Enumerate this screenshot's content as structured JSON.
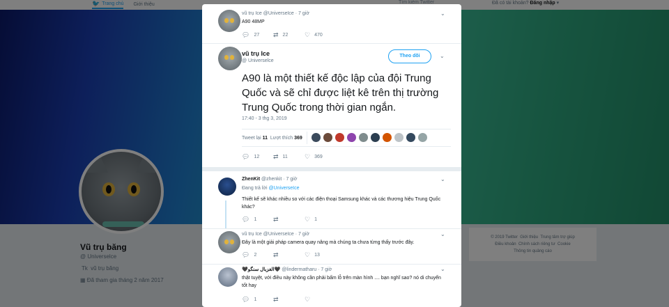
{
  "topbar": {
    "home": "Trang chủ",
    "about": "Giới thiệu",
    "search_placeholder": "Tìm kiếm Twitter",
    "have_account": "Đã có tài khoản?",
    "login": "Đăng nhập"
  },
  "profile": {
    "name": "Vũ trụ băng",
    "handle": "@ Universelce",
    "follows_badge": "Tk",
    "follows_name": "vũ trụ băng",
    "joined": "Đã tham gia tháng 2 năm 2017"
  },
  "footer": {
    "links": [
      "© 2019 Twitter",
      "Giới thiệu",
      "Trung tâm trợ giúp",
      "Điều khoản",
      "Chính sách riêng tư",
      "Cookie",
      "Thông tin quảng cáo"
    ]
  },
  "tweets": {
    "prev": {
      "author": "vũ trụ Ice",
      "handle": "@UniverseIce",
      "time": "· 7 giờ",
      "text": "A90 48MP",
      "replies": "27",
      "retweets": "22",
      "likes": "470"
    },
    "main": {
      "author": "vũ trụ Ice",
      "handle": "@ Universelce",
      "follow": "Theo dõi",
      "text": "A90 là một thiết kế độc lập của đội Trung Quốc và sẽ chỉ được liệt kê trên thị trường Trung Quốc trong thời gian ngắn.",
      "timestamp": "17:40 - 3 thg 3, 2019",
      "retweet_label": "Tweet lại",
      "retweet_count": "11",
      "like_label": "Lượt thích",
      "like_count": "369",
      "likers": [
        "#3b4a5c",
        "#6b4a3a",
        "#c0392b",
        "#8e44ad",
        "#7f8c8d",
        "#2c3e50",
        "#d35400",
        "#bdc3c7",
        "#34495e",
        "#95a5a6"
      ],
      "replies": "12",
      "retweets": "11",
      "likes": "369"
    },
    "reply1": {
      "author": "ZhenKit",
      "handle": "@zhenkit",
      "time": "· 7 giờ",
      "replying": "Đang trả lời",
      "replying_to": "@UniverseIce",
      "text": "Thiết kế sẽ khác nhiều so với các điện thoại Samsung khác và các thương hiệu Trung Quốc khác?",
      "replies": "1",
      "retweets": "",
      "likes": "1"
    },
    "reply2": {
      "author": "vũ trụ Ice",
      "handle": "@UniverseIce",
      "time": "· 7 giờ",
      "text": "Đây là một giải pháp camera quay nâng mà chúng ta chưa từng thấy trước đây.",
      "replies": "2",
      "retweets": "",
      "likes": "13"
    },
    "reply3": {
      "author": "🖤الغزبال سنگو🖤",
      "handle": "@lindermatharu",
      "time": "· 7 giờ",
      "text": "thật tuyệt, với điều này không cần phải bấm lỗ trên màn hình .... bạn nghĩ sao? nó di chuyển tốt hay",
      "replies": "1",
      "retweets": "",
      "likes": ""
    }
  }
}
